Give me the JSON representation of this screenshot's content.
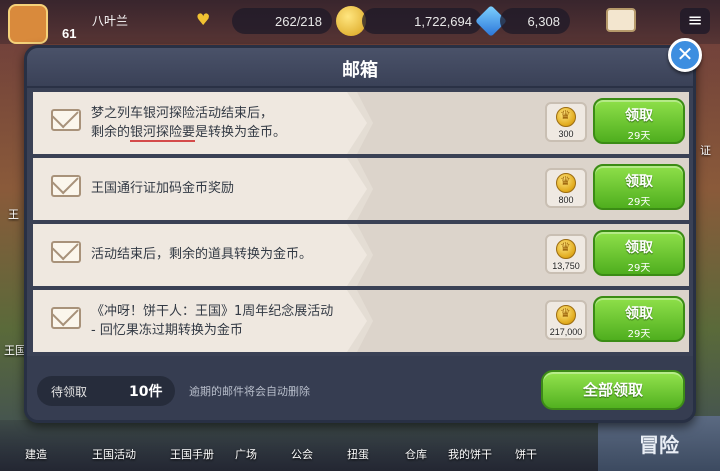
{
  "hud": {
    "player_name": "八叶兰",
    "player_level": "61",
    "stamina": "262/218",
    "coins": "1,722,694",
    "gems": "6,308",
    "menu_icon": "≡"
  },
  "bottom_nav": [
    {
      "label": "建造"
    },
    {
      "label": "王国活动"
    },
    {
      "label": "王国手册"
    },
    {
      "label": "广场"
    },
    {
      "label": "公会"
    },
    {
      "label": "扭蛋"
    },
    {
      "label": "仓库"
    },
    {
      "label": "我的饼干"
    },
    {
      "label": "饼干"
    }
  ],
  "adventure_label": "冒险",
  "side_labels": {
    "left_mid": "王",
    "left_low": "王国",
    "right_mid": "证"
  },
  "mailbox": {
    "title": "邮箱",
    "close_icon": "✕",
    "mails": [
      {
        "line1": "梦之列车银河探险活动结束后，",
        "line2_pre": "剩余的",
        "line2_hl": "银河探险要",
        "line2_post": "是转换为金币。",
        "reward": "300",
        "claim": "领取",
        "days": "29天"
      },
      {
        "line1": "王国通行证加码金币奖励",
        "reward": "800",
        "claim": "领取",
        "days": "29天"
      },
      {
        "line1": "活动结束后，剩余的道具转换为金币。",
        "reward": "13,750",
        "claim": "领取",
        "days": "29天"
      },
      {
        "line1": "《冲呀！饼干人：王国》1周年纪念展活动",
        "line2": "- 回忆果冻过期转换为金币",
        "reward": "217,000",
        "claim": "领取",
        "days": "29天"
      }
    ],
    "pending_label": "待领取",
    "pending_count": "10件",
    "footer_note": "逾期的邮件将会自动删除",
    "claim_all": "全部领取"
  }
}
